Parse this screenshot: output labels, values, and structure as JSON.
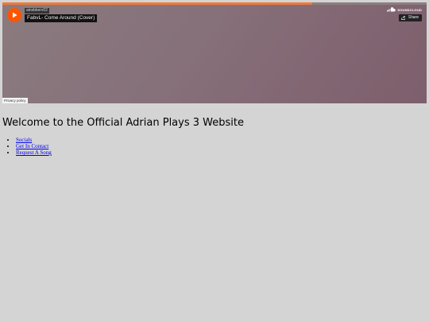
{
  "player": {
    "uploader": "ainsbkerv02",
    "track_title": "FabvL- Come Around (Cover)",
    "brand": "SOUNDCLOUD",
    "share_label": "Share",
    "privacy_label": "Privacy policy",
    "progress": 0.73,
    "colors": {
      "accent": "#ff5500",
      "progress": "#ef7a3a"
    },
    "icons": {
      "play": "play-icon",
      "brand": "soundcloud-icon",
      "share": "share-icon"
    }
  },
  "page": {
    "heading": "Welcome to the Official Adrian Plays 3 Website",
    "nav": [
      {
        "label": "Socials"
      },
      {
        "label": "Get In Contact"
      },
      {
        "label": "Request A Song"
      }
    ]
  }
}
